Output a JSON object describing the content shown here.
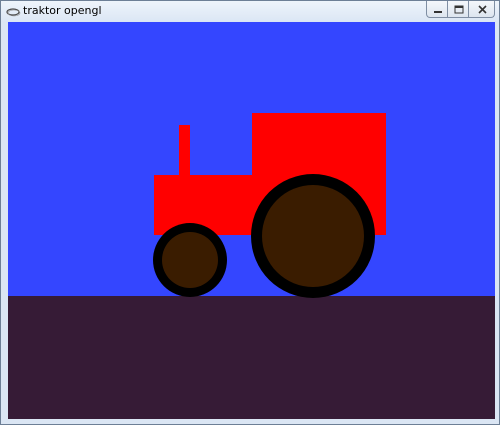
{
  "window": {
    "title": "traktor opengl",
    "icons": {
      "app": "app-icon",
      "minimize": "minimize-icon",
      "maximize": "maximize-icon",
      "close": "close-icon"
    }
  },
  "scene": {
    "colors": {
      "sky": "#3446ff",
      "ground": "#361b36",
      "body": "#ff0000",
      "tire": "#000000",
      "hub": "#3a1c00"
    }
  }
}
